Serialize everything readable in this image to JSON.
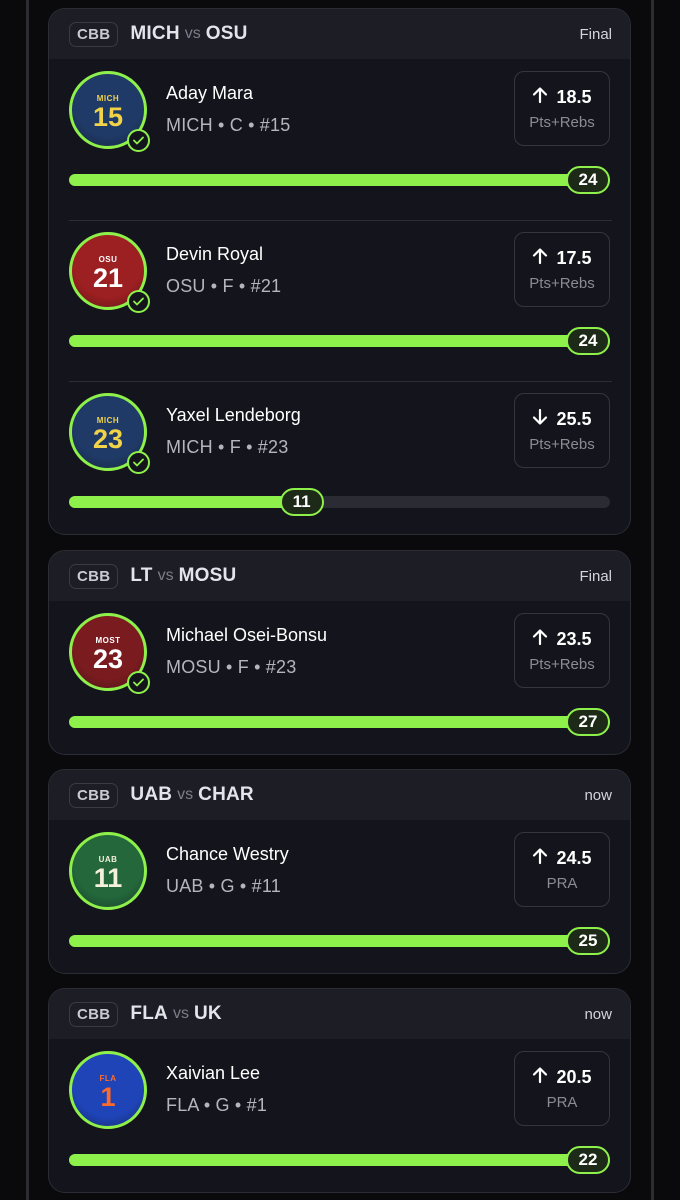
{
  "colors": {
    "accent": "#8ef04a",
    "background": "#0a0a0d",
    "card": "#14151c"
  },
  "games": [
    {
      "league": "CBB",
      "home": "MICH",
      "vs": "vs",
      "away": "OSU",
      "status": "Final",
      "players": [
        {
          "jersey_team": "MICH",
          "number": "15",
          "jersey_color": "#1f3a66",
          "jersey_text": "#f1d34a",
          "checked": true,
          "name": "Aday Mara",
          "meta": "MICH • C • #15",
          "direction": "up",
          "line": "18.5",
          "stat": "Pts+Rebs",
          "actual": "24",
          "progress": 1.0
        },
        {
          "jersey_team": "OSU",
          "number": "21",
          "jersey_color": "#9c1f21",
          "jersey_text": "#ffffff",
          "checked": true,
          "name": "Devin Royal",
          "meta": "OSU • F • #21",
          "direction": "up",
          "line": "17.5",
          "stat": "Pts+Rebs",
          "actual": "24",
          "progress": 1.0
        },
        {
          "jersey_team": "MICH",
          "number": "23",
          "jersey_color": "#1f3a66",
          "jersey_text": "#f1d34a",
          "checked": true,
          "name": "Yaxel Lendeborg",
          "meta": "MICH • F • #23",
          "direction": "down",
          "line": "25.5",
          "stat": "Pts+Rebs",
          "actual": "11",
          "progress": 0.43
        }
      ]
    },
    {
      "league": "CBB",
      "home": "LT",
      "vs": "vs",
      "away": "MOSU",
      "status": "Final",
      "players": [
        {
          "jersey_team": "MOST",
          "number": "23",
          "jersey_color": "#7a1b1f",
          "jersey_text": "#ffffff",
          "checked": true,
          "name": "Michael Osei-Bonsu",
          "meta": "MOSU • F • #23",
          "direction": "up",
          "line": "23.5",
          "stat": "Pts+Rebs",
          "actual": "27",
          "progress": 1.0
        }
      ]
    },
    {
      "league": "CBB",
      "home": "UAB",
      "vs": "vs",
      "away": "CHAR",
      "status": "now",
      "players": [
        {
          "jersey_team": "UAB",
          "number": "11",
          "jersey_color": "#23673b",
          "jersey_text": "#f5f0dc",
          "checked": false,
          "name": "Chance Westry",
          "meta": "UAB • G • #11",
          "direction": "up",
          "line": "24.5",
          "stat": "PRA",
          "actual": "25",
          "progress": 1.0
        }
      ]
    },
    {
      "league": "CBB",
      "home": "FLA",
      "vs": "vs",
      "away": "UK",
      "status": "now",
      "players": [
        {
          "jersey_team": "FLA",
          "number": "1",
          "jersey_color": "#1e44b8",
          "jersey_text": "#ff6a2a",
          "checked": false,
          "name": "Xaivian Lee",
          "meta": "FLA • G • #1",
          "direction": "up",
          "line": "20.5",
          "stat": "PRA",
          "actual": "22",
          "progress": 1.0
        }
      ]
    }
  ]
}
